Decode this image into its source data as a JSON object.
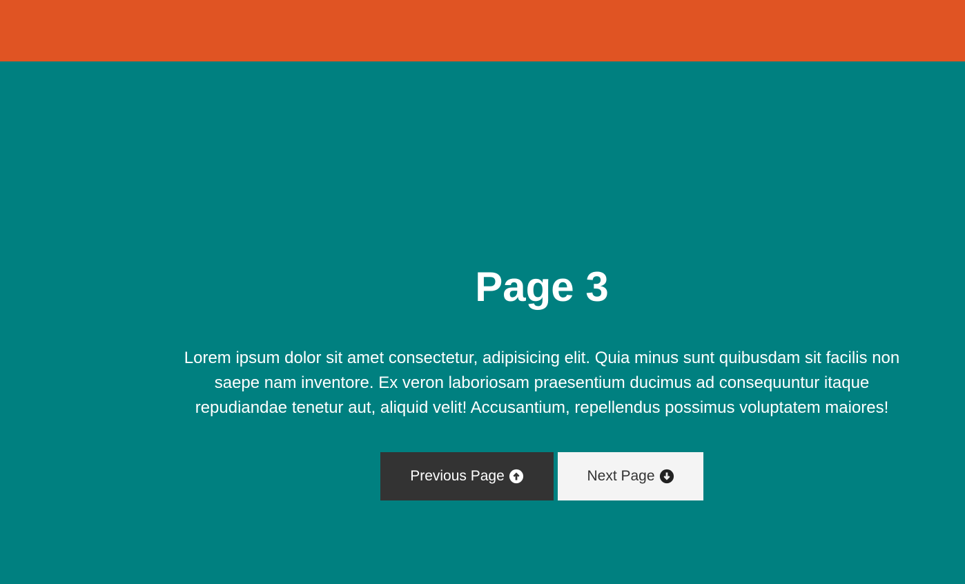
{
  "page": {
    "title": "Page 3",
    "text": "Lorem ipsum dolor sit amet consectetur, adipisicing elit. Quia minus sunt quibusdam sit facilis non saepe nam inventore. Ex veron laboriosam praesentium ducimus ad consequuntur itaque repudiandae tenetur aut, aliquid velit! Accusantium, repellendus possimus voluptatem maiores!"
  },
  "buttons": {
    "previous_label": "Previous Page",
    "next_label": "Next Page",
    "previous_icon": "arrow-circle-up-icon",
    "next_icon": "arrow-circle-down-icon"
  },
  "colors": {
    "top_bar": "#e05423",
    "section_background": "#008080",
    "previous_button": "#333333",
    "next_button": "#f4f4f4"
  }
}
